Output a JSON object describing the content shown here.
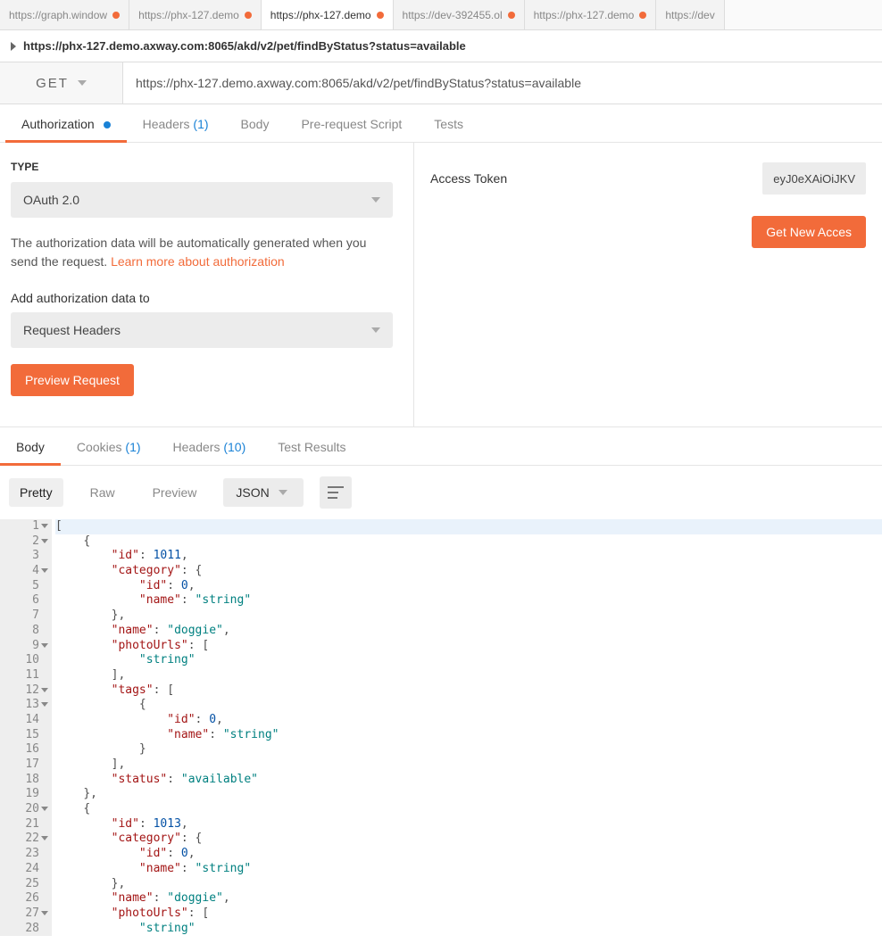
{
  "top_tabs": [
    {
      "label": "https://graph.window",
      "unsaved": true,
      "active": false
    },
    {
      "label": "https://phx-127.demo",
      "unsaved": true,
      "active": false
    },
    {
      "label": "https://phx-127.demo",
      "unsaved": true,
      "active": true
    },
    {
      "label": "https://dev-392455.ol",
      "unsaved": true,
      "active": false
    },
    {
      "label": "https://phx-127.demo",
      "unsaved": true,
      "active": false
    },
    {
      "label": "https://dev",
      "unsaved": false,
      "active": false
    }
  ],
  "request": {
    "title": "https://phx-127.demo.axway.com:8065/akd/v2/pet/findByStatus?status=available",
    "method": "GET",
    "url": "https://phx-127.demo.axway.com:8065/akd/v2/pet/findByStatus?status=available"
  },
  "req_tabs": {
    "authorization": {
      "label": "Authorization",
      "indicator": true
    },
    "headers": {
      "label": "Headers",
      "count": "(1)"
    },
    "body": {
      "label": "Body"
    },
    "prerequest": {
      "label": "Pre-request Script"
    },
    "tests": {
      "label": "Tests"
    }
  },
  "auth": {
    "type_label": "TYPE",
    "type_value": "OAuth 2.0",
    "helper_text": "The authorization data will be automatically generated when you send the request. ",
    "learn_more": "Learn more about authorization",
    "add_to_label": "Add authorization data to",
    "add_to_value": "Request Headers",
    "preview_btn": "Preview Request",
    "access_token_label": "Access Token",
    "access_token_value": "eyJ0eXAiOiJKV",
    "get_token_btn": "Get New Acces"
  },
  "resp_tabs": {
    "body": {
      "label": "Body"
    },
    "cookies": {
      "label": "Cookies",
      "count": "(1)"
    },
    "headers": {
      "label": "Headers",
      "count": "(10)"
    },
    "test_results": {
      "label": "Test Results"
    }
  },
  "resp_toolbar": {
    "pretty": "Pretty",
    "raw": "Raw",
    "preview": "Preview",
    "format": "JSON"
  },
  "code": {
    "lines": [
      {
        "n": 1,
        "fold": true,
        "indent": 0,
        "tokens": [
          [
            "[",
            ""
          ]
        ],
        "hl": true
      },
      {
        "n": 2,
        "fold": true,
        "indent": 1,
        "tokens": [
          [
            "{",
            ""
          ]
        ]
      },
      {
        "n": 3,
        "fold": false,
        "indent": 2,
        "tokens": [
          [
            "\"id\"",
            "key"
          ],
          [
            ": ",
            ""
          ],
          [
            "1011",
            "num"
          ],
          [
            ",",
            ""
          ]
        ]
      },
      {
        "n": 4,
        "fold": true,
        "indent": 2,
        "tokens": [
          [
            "\"category\"",
            "key"
          ],
          [
            ": {",
            ""
          ]
        ]
      },
      {
        "n": 5,
        "fold": false,
        "indent": 3,
        "tokens": [
          [
            "\"id\"",
            "key"
          ],
          [
            ": ",
            ""
          ],
          [
            "0",
            "num"
          ],
          [
            ",",
            ""
          ]
        ]
      },
      {
        "n": 6,
        "fold": false,
        "indent": 3,
        "tokens": [
          [
            "\"name\"",
            "key"
          ],
          [
            ": ",
            ""
          ],
          [
            "\"string\"",
            "str"
          ]
        ]
      },
      {
        "n": 7,
        "fold": false,
        "indent": 2,
        "tokens": [
          [
            "},",
            ""
          ]
        ]
      },
      {
        "n": 8,
        "fold": false,
        "indent": 2,
        "tokens": [
          [
            "\"name\"",
            "key"
          ],
          [
            ": ",
            ""
          ],
          [
            "\"doggie\"",
            "str"
          ],
          [
            ",",
            ""
          ]
        ]
      },
      {
        "n": 9,
        "fold": true,
        "indent": 2,
        "tokens": [
          [
            "\"photoUrls\"",
            "key"
          ],
          [
            ": [",
            ""
          ]
        ]
      },
      {
        "n": 10,
        "fold": false,
        "indent": 3,
        "tokens": [
          [
            "\"string\"",
            "str"
          ]
        ]
      },
      {
        "n": 11,
        "fold": false,
        "indent": 2,
        "tokens": [
          [
            "],",
            ""
          ]
        ]
      },
      {
        "n": 12,
        "fold": true,
        "indent": 2,
        "tokens": [
          [
            "\"tags\"",
            "key"
          ],
          [
            ": [",
            ""
          ]
        ]
      },
      {
        "n": 13,
        "fold": true,
        "indent": 3,
        "tokens": [
          [
            "{",
            ""
          ]
        ]
      },
      {
        "n": 14,
        "fold": false,
        "indent": 4,
        "tokens": [
          [
            "\"id\"",
            "key"
          ],
          [
            ": ",
            ""
          ],
          [
            "0",
            "num"
          ],
          [
            ",",
            ""
          ]
        ]
      },
      {
        "n": 15,
        "fold": false,
        "indent": 4,
        "tokens": [
          [
            "\"name\"",
            "key"
          ],
          [
            ": ",
            ""
          ],
          [
            "\"string\"",
            "str"
          ]
        ]
      },
      {
        "n": 16,
        "fold": false,
        "indent": 3,
        "tokens": [
          [
            "}",
            ""
          ]
        ]
      },
      {
        "n": 17,
        "fold": false,
        "indent": 2,
        "tokens": [
          [
            "],",
            ""
          ]
        ]
      },
      {
        "n": 18,
        "fold": false,
        "indent": 2,
        "tokens": [
          [
            "\"status\"",
            "key"
          ],
          [
            ": ",
            ""
          ],
          [
            "\"available\"",
            "str"
          ]
        ]
      },
      {
        "n": 19,
        "fold": false,
        "indent": 1,
        "tokens": [
          [
            "},",
            ""
          ]
        ]
      },
      {
        "n": 20,
        "fold": true,
        "indent": 1,
        "tokens": [
          [
            "{",
            ""
          ]
        ]
      },
      {
        "n": 21,
        "fold": false,
        "indent": 2,
        "tokens": [
          [
            "\"id\"",
            "key"
          ],
          [
            ": ",
            ""
          ],
          [
            "1013",
            "num"
          ],
          [
            ",",
            ""
          ]
        ]
      },
      {
        "n": 22,
        "fold": true,
        "indent": 2,
        "tokens": [
          [
            "\"category\"",
            "key"
          ],
          [
            ": {",
            ""
          ]
        ]
      },
      {
        "n": 23,
        "fold": false,
        "indent": 3,
        "tokens": [
          [
            "\"id\"",
            "key"
          ],
          [
            ": ",
            ""
          ],
          [
            "0",
            "num"
          ],
          [
            ",",
            ""
          ]
        ]
      },
      {
        "n": 24,
        "fold": false,
        "indent": 3,
        "tokens": [
          [
            "\"name\"",
            "key"
          ],
          [
            ": ",
            ""
          ],
          [
            "\"string\"",
            "str"
          ]
        ]
      },
      {
        "n": 25,
        "fold": false,
        "indent": 2,
        "tokens": [
          [
            "},",
            ""
          ]
        ]
      },
      {
        "n": 26,
        "fold": false,
        "indent": 2,
        "tokens": [
          [
            "\"name\"",
            "key"
          ],
          [
            ": ",
            ""
          ],
          [
            "\"doggie\"",
            "str"
          ],
          [
            ",",
            ""
          ]
        ]
      },
      {
        "n": 27,
        "fold": true,
        "indent": 2,
        "tokens": [
          [
            "\"photoUrls\"",
            "key"
          ],
          [
            ": [",
            ""
          ]
        ]
      },
      {
        "n": 28,
        "fold": false,
        "indent": 3,
        "tokens": [
          [
            "\"string\"",
            "str"
          ]
        ]
      }
    ]
  }
}
